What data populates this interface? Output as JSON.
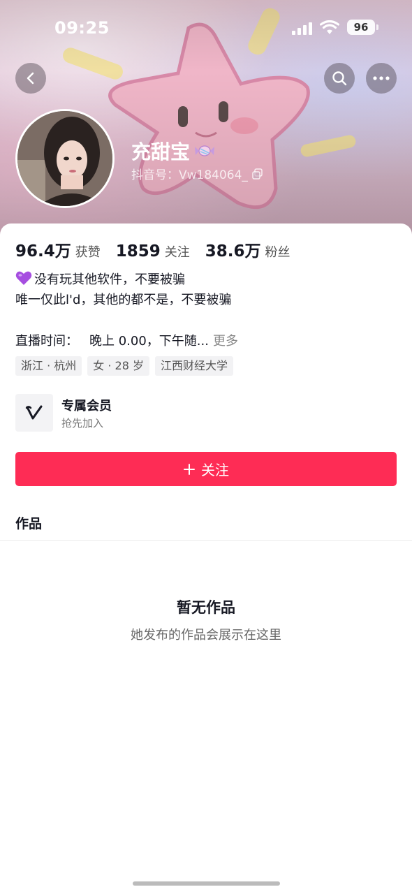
{
  "status_bar": {
    "time": "09:25",
    "battery": "96"
  },
  "profile": {
    "name": "充甜宝",
    "douyin_id": "抖音号：Vw184064_"
  },
  "stats": [
    {
      "value": "96.4万",
      "label": "获赞"
    },
    {
      "value": "1859",
      "label": "关注"
    },
    {
      "value": "38.6万",
      "label": "粉丝"
    }
  ],
  "bio": {
    "line1": "没有玩其他软件，不要被骗",
    "line2": "唯一仅此l'd，其他的都不是，不要被骗"
  },
  "live": {
    "label": "直播时间：",
    "value": "晚上 0.00，下午随...",
    "more": "更多"
  },
  "tags": [
    "浙江 · 杭州",
    "女 · 28 岁",
    "江西财经大学"
  ],
  "member": {
    "title": "专属会员",
    "subtitle": "抢先加入"
  },
  "follow_button": "关注",
  "tabs": {
    "works": "作品"
  },
  "empty": {
    "title": "暂无作品",
    "subtitle": "她发布的作品会展示在这里"
  },
  "colors": {
    "accent": "#fe2c55"
  }
}
